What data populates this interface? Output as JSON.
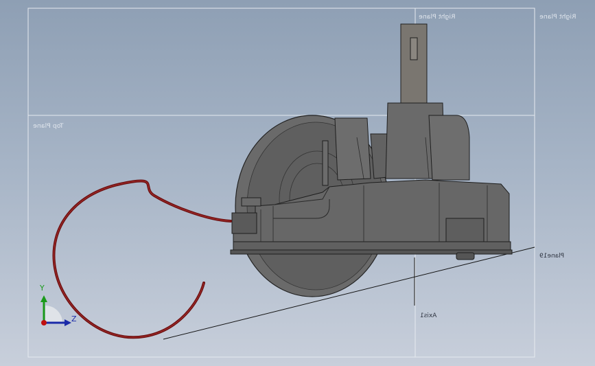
{
  "viewport": {
    "planes": {
      "right_plane": "Right Plane",
      "top_plane_inner": "Top Plane",
      "top_plane_outer": "Right Plane",
      "front_plane": "Plane19",
      "axis": "Axis1"
    },
    "triad": {
      "x": "X",
      "y": "Y",
      "z": "Z"
    },
    "colors": {
      "body": "#5c5c5c",
      "body_light": "#6f6f6f",
      "cable": "#7a1010",
      "plane_line": "#e6eaf0",
      "triad_y": "#1a9a1a",
      "triad_z": "#1a2aa8",
      "triad_x": "#c01010"
    }
  }
}
